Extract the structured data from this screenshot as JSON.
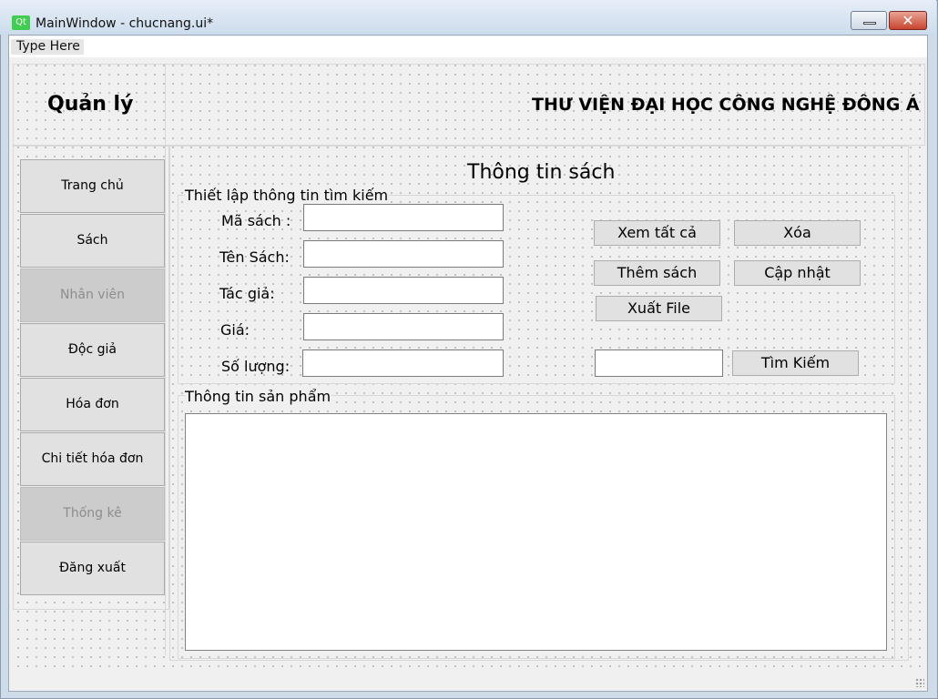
{
  "window": {
    "title": "MainWindow - chucnang.ui*",
    "app_icon_text": "Qt",
    "close_glyph": "✕"
  },
  "menubar": {
    "placeholder_item": "Type Here"
  },
  "header": {
    "title": "Quản lý",
    "banner": "THƯ VIỆN ĐẠI HỌC CÔNG NGHỆ ĐÔNG Á"
  },
  "sidebar": {
    "items": [
      {
        "label": "Trang chủ",
        "enabled": true
      },
      {
        "label": "Sách",
        "enabled": true
      },
      {
        "label": "Nhân viên",
        "enabled": false
      },
      {
        "label": "Độc  giả",
        "enabled": true
      },
      {
        "label": "Hóa đơn",
        "enabled": true
      },
      {
        "label": "Chi tiết hóa đơn",
        "enabled": true
      },
      {
        "label": "Thống kê",
        "enabled": false
      },
      {
        "label": "Đăng xuất",
        "enabled": true
      }
    ]
  },
  "main": {
    "section_title": "Thông tin sách",
    "search_group": {
      "title": "Thiết lập thông tin tìm kiếm",
      "fields": [
        {
          "label": "Mã sách :",
          "value": ""
        },
        {
          "label": "Tên Sách:",
          "value": ""
        },
        {
          "label": "Tác giả:",
          "value": ""
        },
        {
          "label": "Giá:",
          "value": ""
        },
        {
          "label": "Số lượng:",
          "value": ""
        }
      ],
      "buttons": {
        "view_all": "Xem tất cả",
        "delete": "Xóa",
        "add_book": "Thêm sách",
        "update": "Cập nhật",
        "export_file": "Xuất File",
        "search": "Tìm Kiếm"
      },
      "search_input_value": ""
    },
    "product_group": {
      "title": "Thông tin sản phẩm"
    }
  }
}
